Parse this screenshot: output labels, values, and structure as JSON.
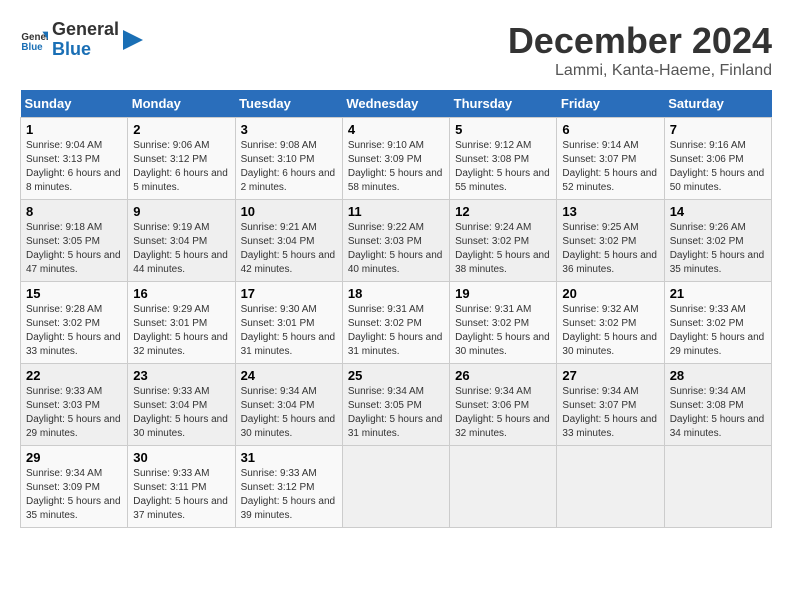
{
  "header": {
    "logo_general": "General",
    "logo_blue": "Blue",
    "month_title": "December 2024",
    "location": "Lammi, Kanta-Haeme, Finland"
  },
  "days_of_week": [
    "Sunday",
    "Monday",
    "Tuesday",
    "Wednesday",
    "Thursday",
    "Friday",
    "Saturday"
  ],
  "weeks": [
    [
      {
        "num": "1",
        "sunrise": "9:04 AM",
        "sunset": "3:13 PM",
        "daylight": "6 hours and 8 minutes."
      },
      {
        "num": "2",
        "sunrise": "9:06 AM",
        "sunset": "3:12 PM",
        "daylight": "6 hours and 5 minutes."
      },
      {
        "num": "3",
        "sunrise": "9:08 AM",
        "sunset": "3:10 PM",
        "daylight": "6 hours and 2 minutes."
      },
      {
        "num": "4",
        "sunrise": "9:10 AM",
        "sunset": "3:09 PM",
        "daylight": "5 hours and 58 minutes."
      },
      {
        "num": "5",
        "sunrise": "9:12 AM",
        "sunset": "3:08 PM",
        "daylight": "5 hours and 55 minutes."
      },
      {
        "num": "6",
        "sunrise": "9:14 AM",
        "sunset": "3:07 PM",
        "daylight": "5 hours and 52 minutes."
      },
      {
        "num": "7",
        "sunrise": "9:16 AM",
        "sunset": "3:06 PM",
        "daylight": "5 hours and 50 minutes."
      }
    ],
    [
      {
        "num": "8",
        "sunrise": "9:18 AM",
        "sunset": "3:05 PM",
        "daylight": "5 hours and 47 minutes."
      },
      {
        "num": "9",
        "sunrise": "9:19 AM",
        "sunset": "3:04 PM",
        "daylight": "5 hours and 44 minutes."
      },
      {
        "num": "10",
        "sunrise": "9:21 AM",
        "sunset": "3:04 PM",
        "daylight": "5 hours and 42 minutes."
      },
      {
        "num": "11",
        "sunrise": "9:22 AM",
        "sunset": "3:03 PM",
        "daylight": "5 hours and 40 minutes."
      },
      {
        "num": "12",
        "sunrise": "9:24 AM",
        "sunset": "3:02 PM",
        "daylight": "5 hours and 38 minutes."
      },
      {
        "num": "13",
        "sunrise": "9:25 AM",
        "sunset": "3:02 PM",
        "daylight": "5 hours and 36 minutes."
      },
      {
        "num": "14",
        "sunrise": "9:26 AM",
        "sunset": "3:02 PM",
        "daylight": "5 hours and 35 minutes."
      }
    ],
    [
      {
        "num": "15",
        "sunrise": "9:28 AM",
        "sunset": "3:02 PM",
        "daylight": "5 hours and 33 minutes."
      },
      {
        "num": "16",
        "sunrise": "9:29 AM",
        "sunset": "3:01 PM",
        "daylight": "5 hours and 32 minutes."
      },
      {
        "num": "17",
        "sunrise": "9:30 AM",
        "sunset": "3:01 PM",
        "daylight": "5 hours and 31 minutes."
      },
      {
        "num": "18",
        "sunrise": "9:31 AM",
        "sunset": "3:02 PM",
        "daylight": "5 hours and 31 minutes."
      },
      {
        "num": "19",
        "sunrise": "9:31 AM",
        "sunset": "3:02 PM",
        "daylight": "5 hours and 30 minutes."
      },
      {
        "num": "20",
        "sunrise": "9:32 AM",
        "sunset": "3:02 PM",
        "daylight": "5 hours and 30 minutes."
      },
      {
        "num": "21",
        "sunrise": "9:33 AM",
        "sunset": "3:02 PM",
        "daylight": "5 hours and 29 minutes."
      }
    ],
    [
      {
        "num": "22",
        "sunrise": "9:33 AM",
        "sunset": "3:03 PM",
        "daylight": "5 hours and 29 minutes."
      },
      {
        "num": "23",
        "sunrise": "9:33 AM",
        "sunset": "3:04 PM",
        "daylight": "5 hours and 30 minutes."
      },
      {
        "num": "24",
        "sunrise": "9:34 AM",
        "sunset": "3:04 PM",
        "daylight": "5 hours and 30 minutes."
      },
      {
        "num": "25",
        "sunrise": "9:34 AM",
        "sunset": "3:05 PM",
        "daylight": "5 hours and 31 minutes."
      },
      {
        "num": "26",
        "sunrise": "9:34 AM",
        "sunset": "3:06 PM",
        "daylight": "5 hours and 32 minutes."
      },
      {
        "num": "27",
        "sunrise": "9:34 AM",
        "sunset": "3:07 PM",
        "daylight": "5 hours and 33 minutes."
      },
      {
        "num": "28",
        "sunrise": "9:34 AM",
        "sunset": "3:08 PM",
        "daylight": "5 hours and 34 minutes."
      }
    ],
    [
      {
        "num": "29",
        "sunrise": "9:34 AM",
        "sunset": "3:09 PM",
        "daylight": "5 hours and 35 minutes."
      },
      {
        "num": "30",
        "sunrise": "9:33 AM",
        "sunset": "3:11 PM",
        "daylight": "5 hours and 37 minutes."
      },
      {
        "num": "31",
        "sunrise": "9:33 AM",
        "sunset": "3:12 PM",
        "daylight": "5 hours and 39 minutes."
      },
      null,
      null,
      null,
      null
    ]
  ]
}
